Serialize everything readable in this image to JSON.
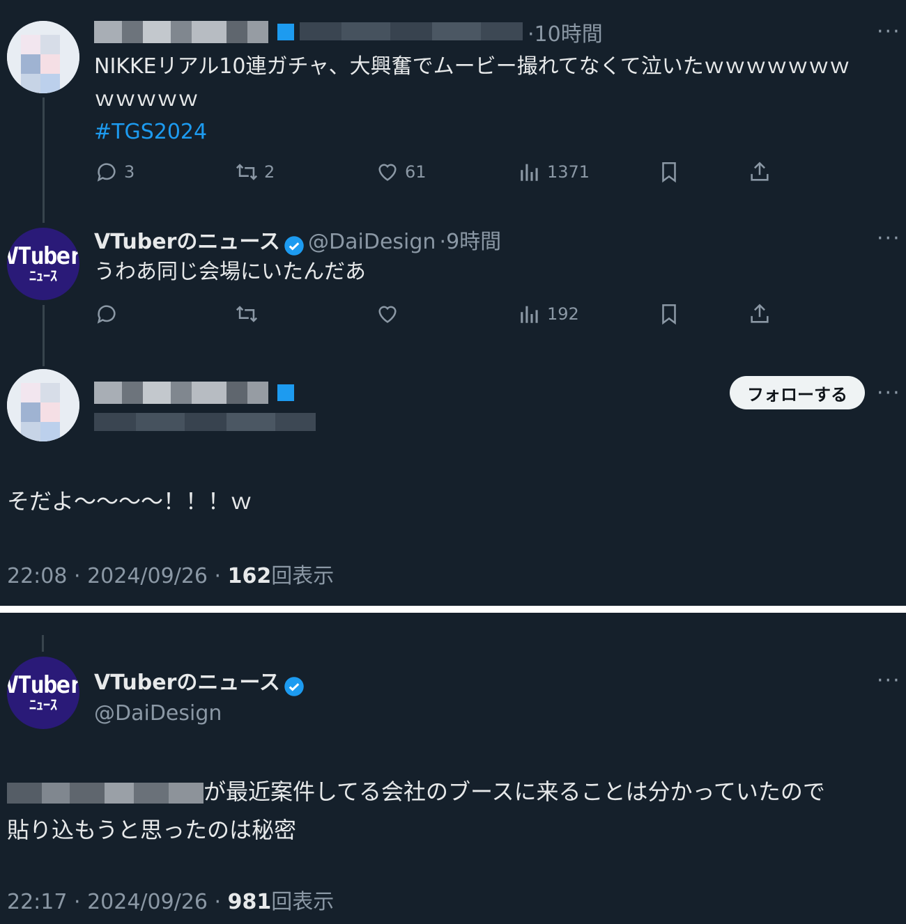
{
  "tweet1": {
    "time": "10時間",
    "text_line1": "NIKKEリアル10連ガチャ、大興奮でムービー撮れてなくて泣いたｗｗｗｗｗｗｗ",
    "text_line2": "ｗｗｗｗｗ",
    "hashtag": "#TGS2024",
    "stats": {
      "replies": "3",
      "reposts": "2",
      "likes": "61",
      "views": "1371"
    }
  },
  "tweet2": {
    "name": "VTuberのニュース",
    "handle": "@DaiDesign",
    "time": "9時間",
    "text": "うわあ同じ会場にいたんだあ",
    "avatar_line1": "VTuber",
    "avatar_line2": "ﾆｭｰｽ",
    "stats": {
      "views": "192"
    }
  },
  "tweet3": {
    "follow_label": "フォローする",
    "text": "そだよ〜〜〜〜！！！ｗ",
    "time": "22:08",
    "date": "2024/09/26",
    "views": "162",
    "views_label": "回表示"
  },
  "tweet4": {
    "name": "VTuberのニュース",
    "handle": "@DaiDesign",
    "avatar_line1": "VTuber",
    "avatar_line2": "ﾆｭｰｽ",
    "text_line1_suffix": "が最近案件してる会社のブースに来ることは分かっていたので",
    "text_line2": "貼り込もうと思ったのは秘密",
    "time": "22:17",
    "date": "2024/09/26",
    "views": "981",
    "views_label": "回表示"
  },
  "colors": {
    "background": "#15202b",
    "text": "#e7e9ea",
    "muted": "#8b98a5",
    "accent": "#1d9bf0",
    "verified": "#1d9bf0"
  }
}
